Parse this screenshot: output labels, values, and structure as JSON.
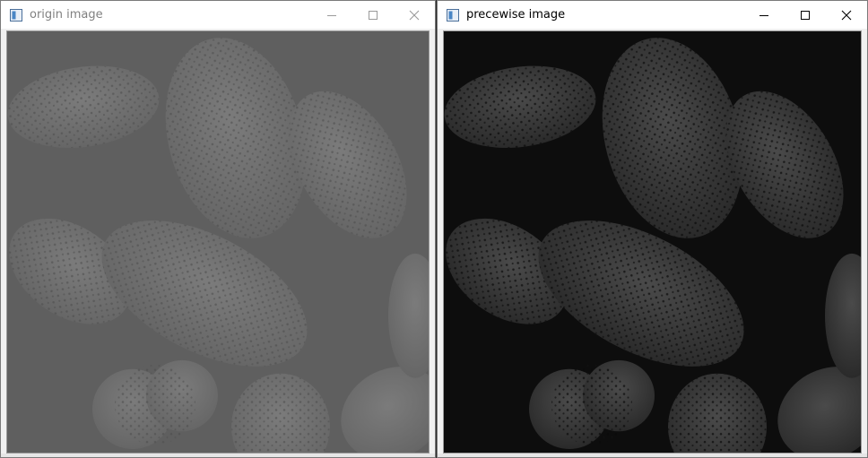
{
  "windows": [
    {
      "title": "origin image",
      "icon": "opencv-window-icon",
      "controls": [
        "minimize-icon",
        "maximize-icon",
        "close-icon"
      ],
      "tone": "low-contrast gray"
    },
    {
      "title": "precewise image",
      "icon": "opencv-window-icon",
      "controls": [
        "minimize-icon",
        "maximize-icon",
        "close-icon"
      ],
      "tone": "dark high-contrast"
    }
  ],
  "colors": {
    "titlebar": "#ffffff",
    "inactive_title": "#808080",
    "active_title": "#000000",
    "origin_background": "#5e5e5e",
    "precewise_background": "#0d0d0d"
  }
}
